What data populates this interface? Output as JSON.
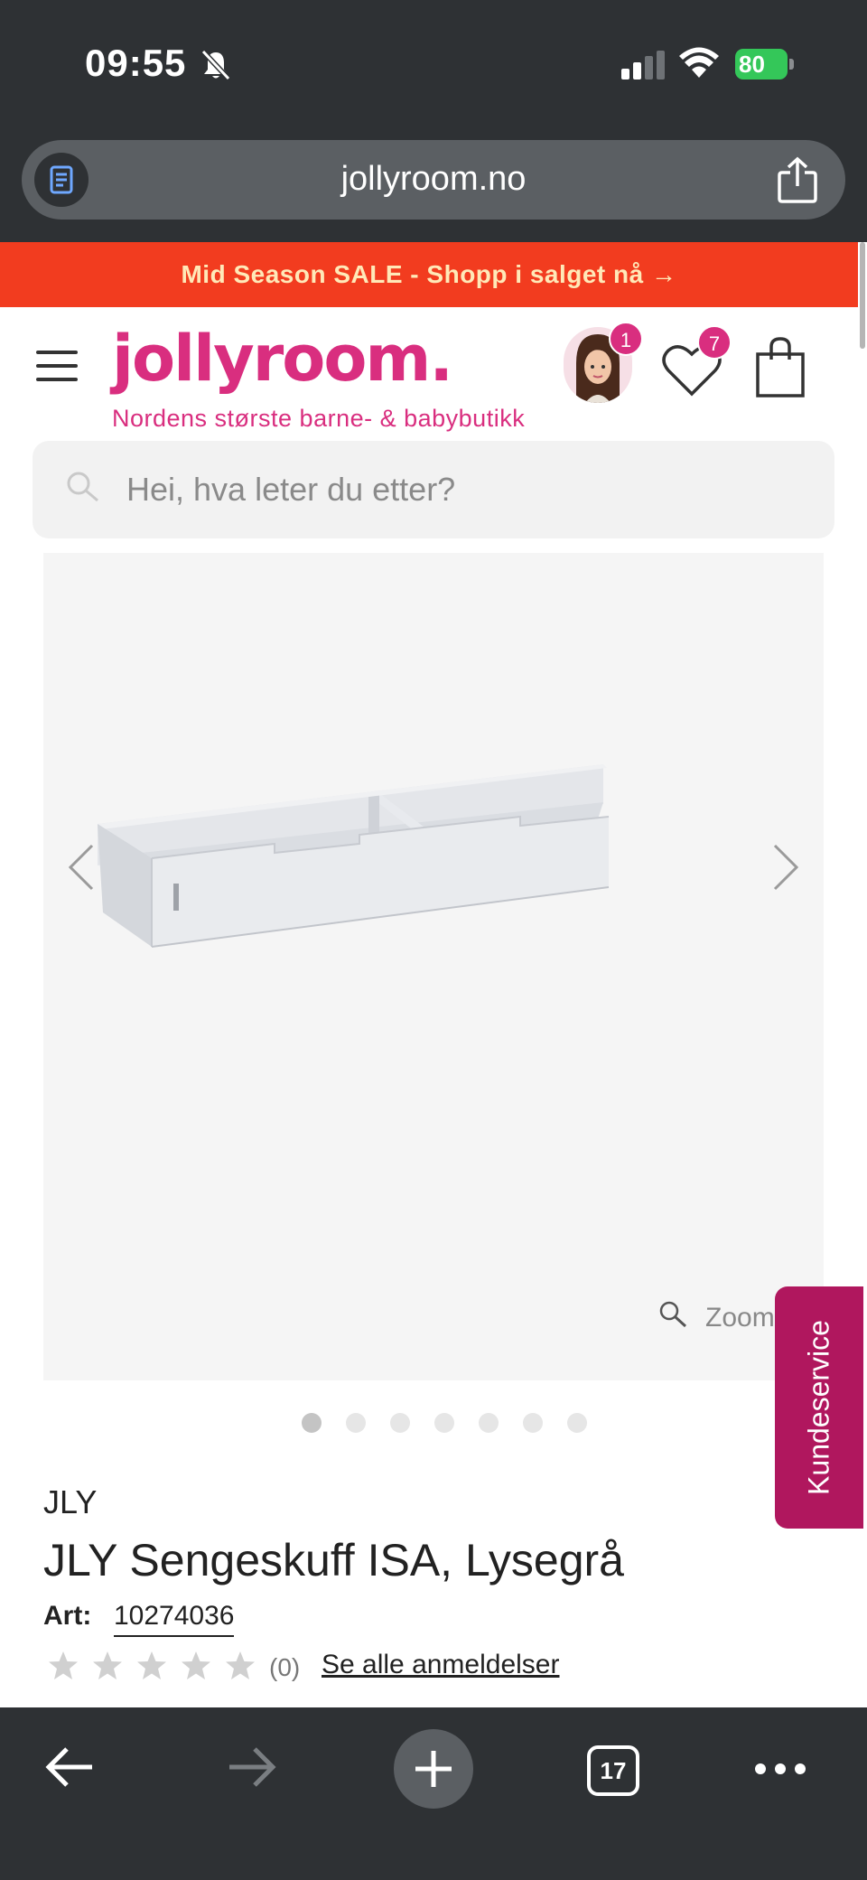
{
  "status_bar": {
    "time": "09:55",
    "battery": "80"
  },
  "browser": {
    "url": "jollyroom.no",
    "tab_count": "17"
  },
  "promo": {
    "text": "Mid Season SALE - Shopp i salget nå →",
    "color": "#f23c1f"
  },
  "header": {
    "logo": "jollyroom.",
    "tagline": "Nordens største barne- & babybutikk",
    "account_badge": "1",
    "wishlist_badge": "7",
    "brand_color": "#d92e7f"
  },
  "search": {
    "placeholder": "Hei, hva leter du etter?"
  },
  "gallery": {
    "zoom_label": "Zoom",
    "image_count": 7,
    "active_index": 0
  },
  "customer_service": {
    "label": "Kundeservice"
  },
  "product": {
    "brand": "JLY",
    "title": "JLY Sengeskuff ISA, Lysegrå",
    "art_label": "Art:",
    "art_number": "10274036",
    "rating": 0,
    "review_count": "(0)",
    "reviews_link": "Se alle anmeldelser"
  }
}
